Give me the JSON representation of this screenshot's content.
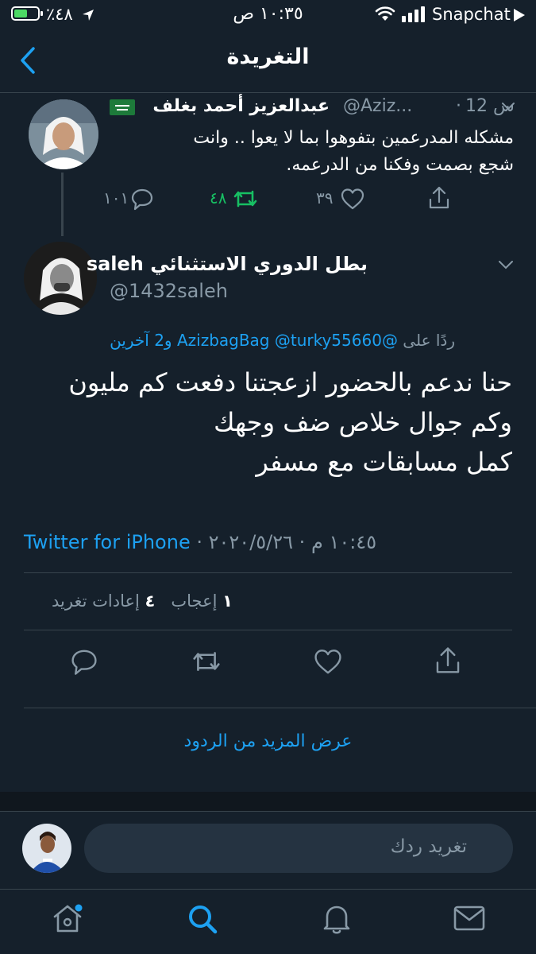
{
  "status_bar": {
    "carrier": "Snapchat",
    "time": "١٠:٣٥ ص",
    "battery": "٪٤٨"
  },
  "header": {
    "title": "التغريدة"
  },
  "parent_tweet": {
    "name": "عبدالعزيز أحمد بغلف",
    "handle": "@Aziz...",
    "time": "12 س",
    "text_line1": "مشكله المدرعمين بتفوهوا بما لا يعوا .. وانت",
    "text_line2": "شجع بصمت وفكنا من الدرعمه.",
    "reply_count": "١٠١",
    "retweet_count": "٤٨",
    "like_count": "٣٩"
  },
  "main_tweet": {
    "name": "بطل الدوري الاستثنائي saleh",
    "handle": "@1432saleh",
    "reply_to_prefix": "ردًا على",
    "reply_to_users": "@AzizbagBag @turky55660",
    "reply_to_others": "و2 آخرين",
    "text_line1": "حنا ندعم بالحضور ازعجتنا دفعت كم مليون",
    "text_line2": "وكم جوال خلاص ضف وجهك",
    "text_line3": "كمل مسابقات مع مسفر",
    "time": "١٠:٤٥ م",
    "date": "٢٠٢٠/٥/٢٦",
    "source": "Twitter for iPhone",
    "likes_count": "١",
    "likes_label": "إعجاب",
    "retweets_count": "٤",
    "retweets_label": "إعادات تغريد"
  },
  "more_replies": {
    "label": "عرض المزيد من الردود"
  },
  "composer": {
    "placeholder": "تغريد ردك"
  },
  "tab_bar": {
    "items": [
      "home-icon",
      "search-icon",
      "notifications-icon",
      "messages-icon"
    ],
    "active": "search-icon"
  },
  "colors": {
    "background": "#15202b",
    "accent": "#1da1f2",
    "retweet_active": "#17bf63",
    "muted": "#8899a6",
    "divider": "#38444d"
  }
}
